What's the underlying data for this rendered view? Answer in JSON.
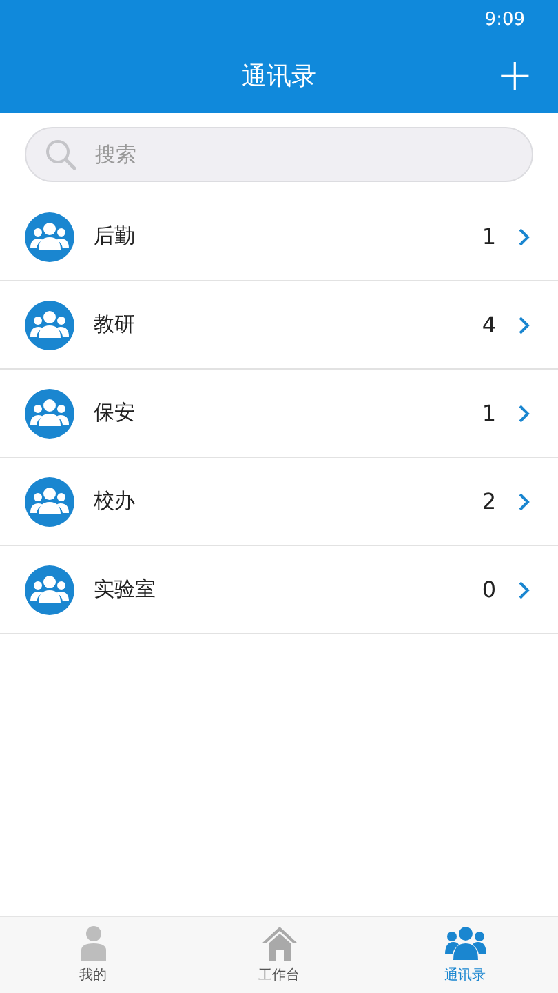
{
  "status_bar": {
    "time": "9:09"
  },
  "header": {
    "title": "通讯录",
    "add_button": "+"
  },
  "search": {
    "placeholder": "搜索"
  },
  "groups": [
    {
      "name": "后勤",
      "count": "1"
    },
    {
      "name": "教研",
      "count": "4"
    },
    {
      "name": "保安",
      "count": "1"
    },
    {
      "name": "校办",
      "count": "2"
    },
    {
      "name": "实验室",
      "count": "0"
    }
  ],
  "tabs": [
    {
      "label": "我的",
      "kind": "person",
      "selected": false
    },
    {
      "label": "工作台",
      "kind": "home",
      "selected": false
    },
    {
      "label": "通讯录",
      "kind": "group",
      "selected": true
    }
  ]
}
